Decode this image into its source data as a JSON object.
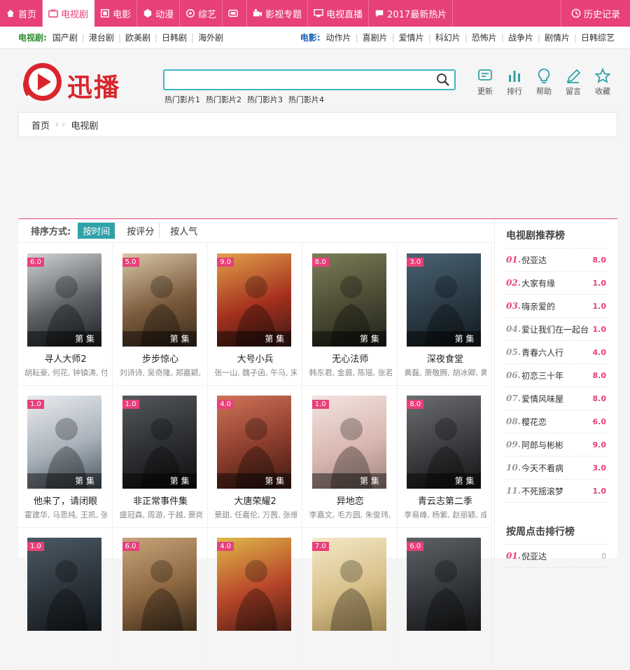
{
  "topnav": [
    {
      "label": "首页",
      "icon": "home-icon",
      "active": false
    },
    {
      "label": "电视剧",
      "icon": "tv-icon",
      "active": true
    },
    {
      "label": "电影",
      "icon": "film-icon",
      "active": false
    },
    {
      "label": "动漫",
      "icon": "anime-icon",
      "active": false
    },
    {
      "label": "综艺",
      "icon": "variety-icon",
      "active": false
    },
    {
      "label": "",
      "icon": "hd-icon",
      "active": false
    },
    {
      "label": "影视专题",
      "icon": "camera-icon",
      "active": false
    },
    {
      "label": "电视直播",
      "icon": "monitor-icon",
      "active": false
    },
    {
      "label": "2017最新热片",
      "icon": "chat-icon",
      "active": false
    }
  ],
  "history_label": "历史记录",
  "subnav": {
    "tv_label": "电视剧:",
    "tv_links": [
      "国产剧",
      "港台剧",
      "欧美剧",
      "日韩剧",
      "海外剧"
    ],
    "movie_label": "电影:",
    "movie_links": [
      "动作片",
      "喜剧片",
      "爱情片",
      "科幻片",
      "恐怖片",
      "战争片",
      "剧情片",
      "日韩综艺"
    ]
  },
  "logo_text": "迅播",
  "search": {
    "value": "",
    "placeholder": ""
  },
  "hotwords": [
    "热门影片1",
    "热门影片2",
    "热门影片3",
    "热门影片4"
  ],
  "tools": [
    {
      "label": "更新",
      "icon": "update-icon"
    },
    {
      "label": "排行",
      "icon": "ranking-icon"
    },
    {
      "label": "帮助",
      "icon": "help-icon"
    },
    {
      "label": "留言",
      "icon": "message-icon"
    },
    {
      "label": "收藏",
      "icon": "favorite-icon"
    }
  ],
  "breadcrumb": [
    "首页",
    "电视剧"
  ],
  "sort": {
    "label": "排序方式:",
    "options": [
      "按时间",
      "按评分",
      "按人气"
    ],
    "active": 0
  },
  "cards": [
    {
      "title": "寻人大师2",
      "actors": "胡耘豪, 何花, 钟镇涛, 付",
      "score": "6.0",
      "ep": "第 集",
      "colors": [
        "#cfd3d6",
        "#5c5f63",
        "#1e2226"
      ]
    },
    {
      "title": "步步惊心",
      "actors": "刘诗诗, 吴奇隆, 郑嘉颖,",
      "score": "5.0",
      "ep": "第 集",
      "colors": [
        "#d8c7a6",
        "#7a5a3c",
        "#3c2a1c"
      ]
    },
    {
      "title": "大号小兵",
      "actors": "张一山, 魏子函, 午马, 宋",
      "score": "9.0",
      "ep": "第 集",
      "colors": [
        "#e2a14a",
        "#a5301e",
        "#3a1a14"
      ]
    },
    {
      "title": "无心法师",
      "actors": "韩东君, 金晨, 陈瑶, 张若",
      "score": "8.0",
      "ep": "第 集",
      "colors": [
        "#7d7e58",
        "#4a4a34",
        "#20201a"
      ]
    },
    {
      "title": "深夜食堂",
      "actors": "黄磊, 萧敬腾, 胡冰卿, 黄",
      "score": "3.0",
      "ep": "第 集",
      "colors": [
        "#4a6373",
        "#2a3a45",
        "#111a20"
      ]
    },
    {
      "title": "他来了，请闭眼",
      "actors": "霍建华, 马思纯, 王凯, 张",
      "score": "1.0",
      "ep": "第 集",
      "colors": [
        "#e9ecef",
        "#a9b2ba",
        "#4a5560"
      ]
    },
    {
      "title": "非正常事件集",
      "actors": "盛冠森, 周游, 于越, 景岗",
      "score": "1.0",
      "ep": "第 集",
      "colors": [
        "#55585c",
        "#2b2d30",
        "#0e0f10"
      ]
    },
    {
      "title": "大唐荣耀2",
      "actors": "景甜, 任嘉伦, 万茜, 张维",
      "score": "4.0",
      "ep": "第 集",
      "colors": [
        "#d07458",
        "#8a3c2c",
        "#3c1a14"
      ]
    },
    {
      "title": "异地恋",
      "actors": "李嘉文, 毛方圆, 朱俊玮,",
      "score": "1.0",
      "ep": "第 集",
      "colors": [
        "#f3e4e1",
        "#d9b8b0",
        "#a0857d"
      ]
    },
    {
      "title": "青云志第二季",
      "actors": "李易峰, 杨紫, 赵丽颖, 成",
      "score": "8.0",
      "ep": "第 集",
      "colors": [
        "#6b6d70",
        "#3a3c3f",
        "#141516"
      ]
    },
    {
      "title": "",
      "actors": "",
      "score": "1.0",
      "ep": "",
      "colors": [
        "#4b5a66",
        "#2c343b",
        "#11161a"
      ]
    },
    {
      "title": "",
      "actors": "",
      "score": "6.0",
      "ep": "",
      "colors": [
        "#c9a57b",
        "#8b6640",
        "#3a2a1a"
      ]
    },
    {
      "title": "",
      "actors": "",
      "score": "4.0",
      "ep": "",
      "colors": [
        "#e0b949",
        "#b8462a",
        "#4a1e14"
      ]
    },
    {
      "title": "",
      "actors": "",
      "score": "7.0",
      "ep": "",
      "colors": [
        "#f4e9c8",
        "#d8c08a",
        "#9c8450"
      ]
    },
    {
      "title": "",
      "actors": "",
      "score": "6.0",
      "ep": "",
      "colors": [
        "#5e6266",
        "#33363a",
        "#121314"
      ]
    }
  ],
  "sidebar": {
    "title": "电视剧推荐榜",
    "items": [
      {
        "no": "01.",
        "name": "倪亚达",
        "score": "8.0"
      },
      {
        "no": "02.",
        "name": "大家有缘",
        "score": "1.0"
      },
      {
        "no": "03.",
        "name": "嗨亲爱的",
        "score": "1.0"
      },
      {
        "no": "04.",
        "name": "爱让我们在一起台",
        "score": "1.0"
      },
      {
        "no": "05.",
        "name": "青春六人行",
        "score": "4.0"
      },
      {
        "no": "06.",
        "name": "初恋三十年",
        "score": "8.0"
      },
      {
        "no": "07.",
        "name": "爱情风味屋",
        "score": "8.0"
      },
      {
        "no": "08.",
        "name": "樱花恋",
        "score": "6.0"
      },
      {
        "no": "09.",
        "name": "阿郎与彬彬",
        "score": "9.0"
      },
      {
        "no": "10.",
        "name": "今天不看病",
        "score": "3.0"
      },
      {
        "no": "11.",
        "name": "不死摇滚梦",
        "score": "1.0"
      }
    ],
    "title2": "按周点击排行榜",
    "items2": [
      {
        "no": "01.",
        "name": "倪亚达",
        "score": "0"
      }
    ]
  }
}
